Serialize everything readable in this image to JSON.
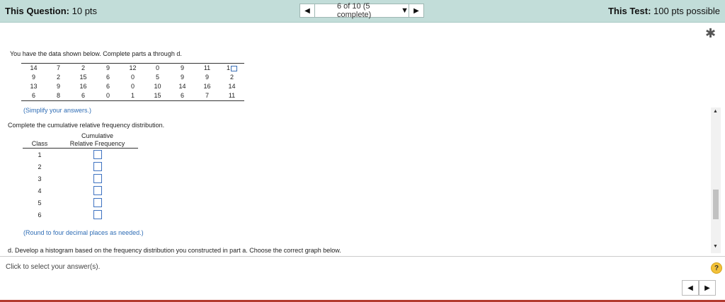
{
  "header": {
    "question_label": "This Question:",
    "question_points": "10 pts",
    "nav_prev": "◀",
    "nav_selector": "6 of 10 (5 complete)",
    "nav_caret": "▼",
    "nav_next": "▶",
    "test_label": "This Test:",
    "test_points": "100 pts possible"
  },
  "intro": "You have the data shown below. Complete parts a through d.",
  "data_table": [
    [
      "14",
      "7",
      "2",
      "9",
      "12",
      "0",
      "9",
      "11",
      "1"
    ],
    [
      "9",
      "2",
      "15",
      "6",
      "0",
      "5",
      "9",
      "9",
      "2"
    ],
    [
      "13",
      "9",
      "16",
      "6",
      "0",
      "10",
      "14",
      "16",
      "14"
    ],
    [
      "6",
      "8",
      "6",
      "0",
      "1",
      "15",
      "6",
      "7",
      "11"
    ]
  ],
  "note_simplify": "(Simplify your answers.)",
  "prompt_cumulative": "Complete the cumulative relative frequency distribution.",
  "crf_table": {
    "header_class": "Class",
    "header_crf_line1": "Cumulative",
    "header_crf_line2": "Relative Frequency",
    "classes": [
      "1",
      "2",
      "3",
      "4",
      "5",
      "6"
    ]
  },
  "note_round": "(Round to four decimal places as needed.)",
  "part_d": "d. Develop a histogram based on the frequency distribution you constructed in part a. Choose the correct graph below.",
  "footer": {
    "click_select": "Click to select your answer(s).",
    "help": "?",
    "prev": "◀",
    "next": "▶"
  },
  "colors": {
    "header_bg": "#c2ddd9",
    "link_blue": "#2f6db5",
    "help_yellow": "#f3c23a",
    "bottom_red": "#b33a2e"
  }
}
